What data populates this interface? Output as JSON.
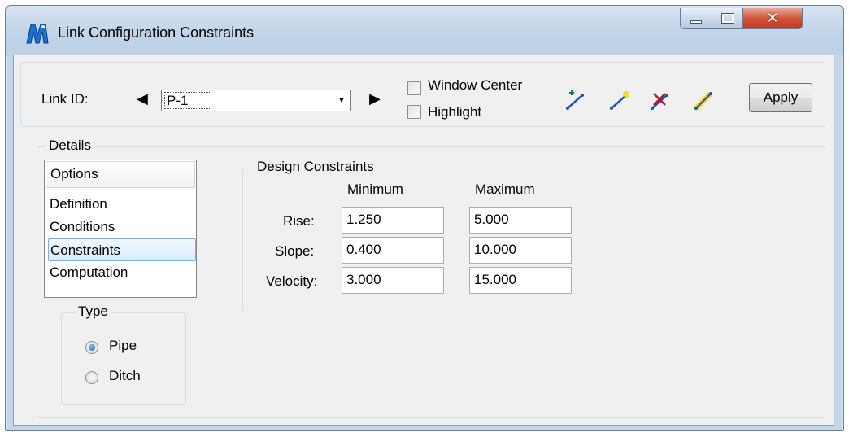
{
  "window": {
    "title": "Link Configuration Constraints"
  },
  "toolbar": {
    "link_id_label": "Link ID:",
    "link_id_value": "P-1",
    "window_center_label": "Window Center",
    "highlight_label": "Highlight",
    "apply_label": "Apply"
  },
  "details": {
    "title": "Details",
    "options_header": "Options",
    "options": [
      {
        "label": "Definition",
        "selected": false
      },
      {
        "label": "Conditions",
        "selected": false
      },
      {
        "label": "Constraints",
        "selected": true
      },
      {
        "label": "Computation",
        "selected": false
      }
    ],
    "type": {
      "title": "Type",
      "options": [
        {
          "label": "Pipe",
          "checked": true
        },
        {
          "label": "Ditch",
          "checked": false
        }
      ]
    }
  },
  "design_constraints": {
    "title": "Design Constraints",
    "min_header": "Minimum",
    "max_header": "Maximum",
    "rows": [
      {
        "label": "Rise:",
        "min": "1.250",
        "max": "5.000"
      },
      {
        "label": "Slope:",
        "min": "0.400",
        "max": "10.000"
      },
      {
        "label": "Velocity:",
        "min": "3.000",
        "max": "15.000"
      }
    ]
  },
  "colors": {
    "title_bg": "#c4d7ea",
    "client_bg": "#f0f0f0",
    "close_red": "#c23a1f",
    "selection_border": "#84acdd"
  },
  "icons": {
    "app": "microstation-m-icon",
    "prev": "triangle-left-icon",
    "next": "triangle-right-icon",
    "tools": [
      "add-link-icon",
      "select-link-icon",
      "delete-link-icon",
      "highlight-link-icon"
    ]
  }
}
